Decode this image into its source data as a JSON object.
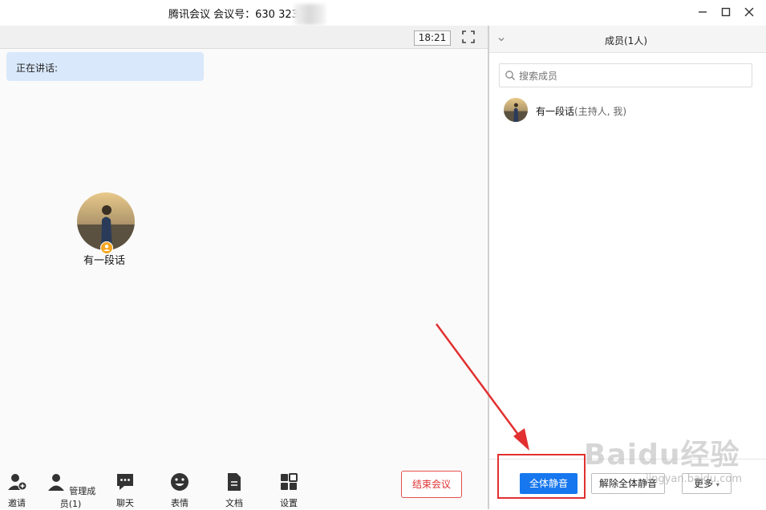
{
  "titlebar": {
    "title": "腾讯会议 会议号：630 323",
    "minimize_icon": "minimize-icon",
    "maximize_icon": "maximize-icon",
    "close_icon": "close-icon"
  },
  "video_area": {
    "clock": "18:21",
    "speaking_label": "正在讲话:",
    "participant_name": "有一段话"
  },
  "toolbar": {
    "items": [
      {
        "label": "邀请",
        "icon": "invite-icon"
      },
      {
        "label": "管理成员(1)",
        "icon": "members-icon"
      },
      {
        "label": "聊天",
        "icon": "chat-icon"
      },
      {
        "label": "表情",
        "icon": "emoji-icon"
      },
      {
        "label": "文档",
        "icon": "document-icon"
      },
      {
        "label": "设置",
        "icon": "settings-icon"
      }
    ],
    "end_meeting": "结束会议"
  },
  "members_panel": {
    "title": "成员(1人)",
    "search_placeholder": "搜索成员",
    "members": [
      {
        "name": "有一段话",
        "role": "(主持人, 我)"
      }
    ],
    "mute_all": "全体静音",
    "unmute_all": "解除全体静音",
    "more": "更多"
  },
  "colors": {
    "accent": "#1677ee",
    "danger": "#e03030",
    "speaking_bg": "#d9e8fb"
  },
  "watermark": {
    "main": "Baidu经验",
    "sub": "jingyan.baidu.com"
  }
}
